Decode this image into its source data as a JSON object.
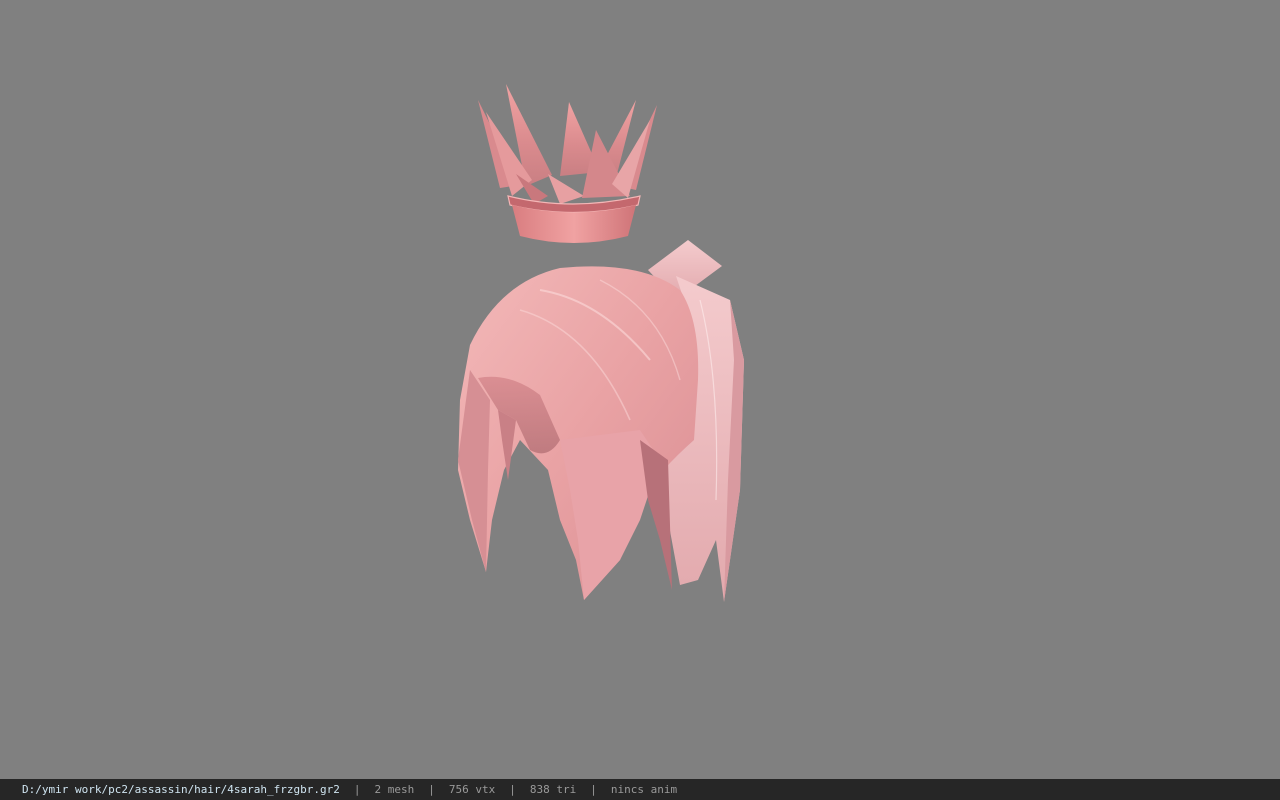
{
  "viewer": {
    "background_color": "#808080",
    "model_color": "#e99a9a",
    "model_meshes": [
      "crown",
      "hair"
    ]
  },
  "statusbar": {
    "file_path": "D:/ymir work/pc2/assassin/hair/4sarah_frzgbr.gr2",
    "separator": "|",
    "mesh_count": "2 mesh",
    "vertex_count": "756 vtx",
    "triangle_count": "838 tri",
    "anim_status": "nincs anim"
  }
}
